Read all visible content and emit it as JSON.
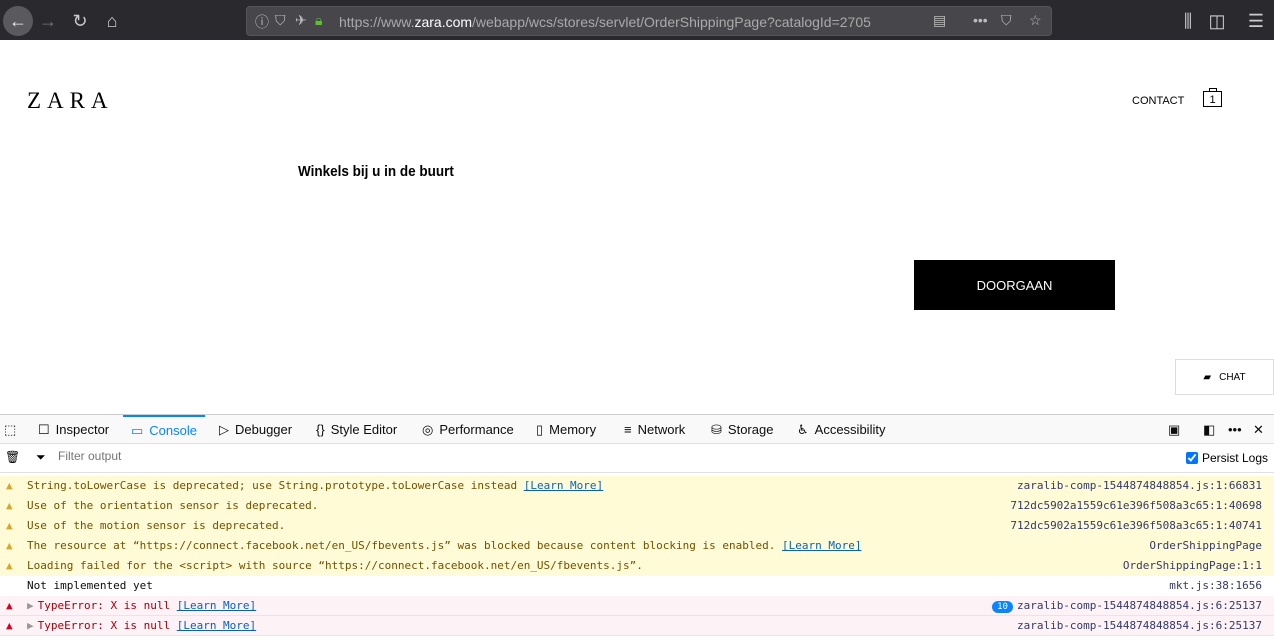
{
  "browser": {
    "url_prefix": "https://www.",
    "url_domain": "zara.com",
    "url_rest": "/webapp/wcs/stores/servlet/OrderShippingPage?catalogId=2705"
  },
  "page": {
    "logo": "ZARA",
    "contact": "CONTACT",
    "bag_count": "1",
    "heading": "Winkels bij u in de buurt",
    "continue": "DOORGAAN",
    "chat": "CHAT"
  },
  "devtools": {
    "tabs": [
      "Inspector",
      "Console",
      "Debugger",
      "Style Editor",
      "Performance",
      "Memory",
      "Network",
      "Storage",
      "Accessibility"
    ],
    "filter_placeholder": "Filter output",
    "persist_logs": "Persist Logs",
    "messages": [
      {
        "level": "warn",
        "text": "String.toLowerCase is deprecated; use String.prototype.toLowerCase instead",
        "link": "[Learn More]",
        "source": "zaralib-comp-1544874848854.js:1:66831"
      },
      {
        "level": "warn",
        "text": "Use of the orientation sensor is deprecated.",
        "source": "712dc5902a1559c61e396f508a3c65:1:40698"
      },
      {
        "level": "warn",
        "text": "Use of the motion sensor is deprecated.",
        "source": "712dc5902a1559c61e396f508a3c65:1:40741"
      },
      {
        "level": "warn",
        "text": "The resource at “https://connect.facebook.net/en_US/fbevents.js” was blocked because content blocking is enabled.",
        "link": "[Learn More]",
        "source": "OrderShippingPage"
      },
      {
        "level": "warn",
        "text": "Loading failed for the <script> with source “https://connect.facebook.net/en_US/fbevents.js”.",
        "source": "OrderShippingPage:1:1"
      },
      {
        "level": "log",
        "text": "Not implemented yet",
        "source": "mkt.js:38:1656"
      },
      {
        "level": "err",
        "text": "TypeError: X is null",
        "link": "[Learn More]",
        "count": "10",
        "source": "zaralib-comp-1544874848854.js:6:25137"
      },
      {
        "level": "err",
        "text": "TypeError: X is null",
        "link": "[Learn More]",
        "source": "zaralib-comp-1544874848854.js:6:25137"
      }
    ]
  }
}
